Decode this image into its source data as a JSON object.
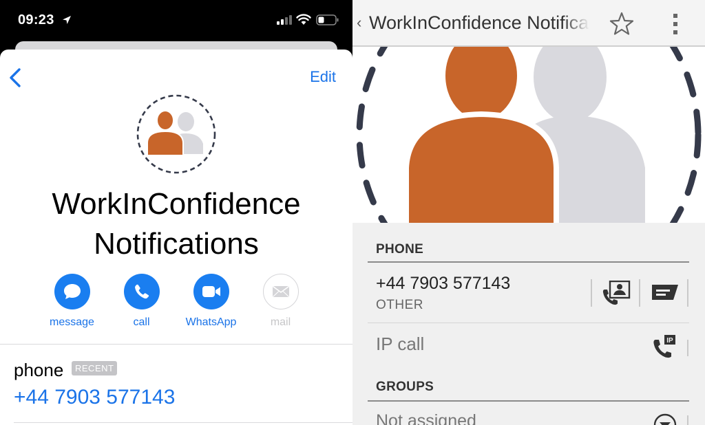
{
  "ios": {
    "status": {
      "time": "09:23"
    },
    "nav": {
      "edit_label": "Edit"
    },
    "contact": {
      "name_line1": "WorkInConfidence",
      "name_line2": "Notifications"
    },
    "actions": [
      {
        "label": "message",
        "icon": "message-bubble-icon",
        "enabled": true
      },
      {
        "label": "call",
        "icon": "phone-icon",
        "enabled": true
      },
      {
        "label": "WhatsApp",
        "icon": "video-icon",
        "enabled": true
      },
      {
        "label": "mail",
        "icon": "envelope-icon",
        "enabled": false
      }
    ],
    "phone": {
      "label": "phone",
      "badge": "RECENT",
      "number": "+44 7903 577143"
    },
    "colors": {
      "accent": "#1a73e8",
      "action_blue": "#1a7ef0",
      "avatar_orange": "#c8652a",
      "avatar_gray": "#d9d9de"
    }
  },
  "android": {
    "title": "WorkInConfidence Notifications",
    "sections": {
      "phone_header": "PHONE",
      "groups_header": "GROUPS"
    },
    "phone": {
      "number": "+44 7903 577143",
      "type": "OTHER"
    },
    "ip_call": "IP call",
    "groups_value": "Not assigned",
    "colors": {
      "avatar_orange": "#c8652a",
      "avatar_gray": "#d9d9de",
      "dash": "#353a4a"
    }
  }
}
